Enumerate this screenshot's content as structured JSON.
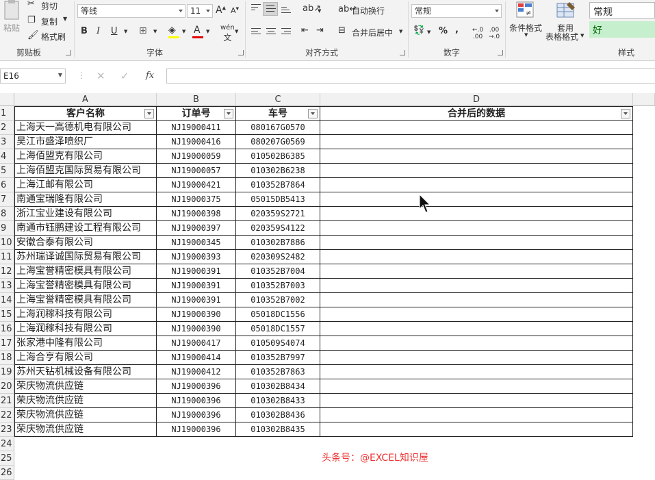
{
  "ribbon": {
    "clipboard": {
      "paste": "粘贴",
      "cut": "剪切",
      "copy": "复制",
      "format_painter": "格式刷",
      "label": "剪贴板"
    },
    "font": {
      "name": "等线",
      "size": "11",
      "bold": "B",
      "italic": "I",
      "underline": "U",
      "label": "字体"
    },
    "alignment": {
      "wrap_text": "自动换行",
      "merge_center": "合并后居中",
      "label": "对齐方式"
    },
    "number": {
      "format": "常规",
      "percent": "%",
      "comma": ",",
      "label": "数字"
    },
    "styles": {
      "conditional": "条件格式",
      "table_line1": "套用",
      "table_line2": "表格格式",
      "normal": "常规",
      "good": "好",
      "label": "样式"
    }
  },
  "formula_bar": {
    "name_box": "E16",
    "fx": "fx",
    "value": ""
  },
  "columns": [
    "A",
    "B",
    "C",
    "D"
  ],
  "headers": [
    "客户名称",
    "订单号",
    "车号",
    "合并后的数据"
  ],
  "rows": [
    [
      "上海天一高德机电有限公司",
      "NJ19000411",
      "080167G0570",
      ""
    ],
    [
      "吴江市盛泽喷织厂",
      "NJ19000416",
      "080207G0569",
      ""
    ],
    [
      "上海佰盟克有限公司",
      "NJ19000059",
      "010502B6385",
      ""
    ],
    [
      "上海佰盟克国际贸易有限公司",
      "NJ19000057",
      "010302B6238",
      ""
    ],
    [
      "上海江邮有限公司",
      "NJ19000421",
      "010352B7864",
      ""
    ],
    [
      "南通宝瑞隆有限公司",
      "NJ19000375",
      "05015DB5413",
      ""
    ],
    [
      "浙江宝业建设有限公司",
      "NJ19000398",
      "020359S2721",
      ""
    ],
    [
      "南通市钰鹏建设工程有限公司",
      "NJ19000397",
      "020359S4122",
      ""
    ],
    [
      "安徽合泰有限公司",
      "NJ19000345",
      "010302B7886",
      ""
    ],
    [
      "苏州瑞译诚国际贸易有限公司",
      "NJ19000393",
      "020309S2482",
      ""
    ],
    [
      "上海宝誉精密模具有限公司",
      "NJ19000391",
      "010352B7004",
      ""
    ],
    [
      "上海宝誉精密模具有限公司",
      "NJ19000391",
      "010352B7003",
      ""
    ],
    [
      "上海宝誉精密模具有限公司",
      "NJ19000391",
      "010352B7002",
      ""
    ],
    [
      "上海润稼科技有限公司",
      "NJ19000390",
      "05018DC1556",
      ""
    ],
    [
      "上海润稼科技有限公司",
      "NJ19000390",
      "05018DC1557",
      ""
    ],
    [
      "张家港中隆有限公司",
      "NJ19000417",
      "010509S4074",
      ""
    ],
    [
      "上海合亨有限公司",
      "NJ19000414",
      "010352B7997",
      ""
    ],
    [
      "苏州天钻机械设备有限公司",
      "NJ19000412",
      "010352B7863",
      ""
    ],
    [
      "荣庆物流供应链",
      "NJ19000396",
      "010302B8434",
      ""
    ],
    [
      "荣庆物流供应链",
      "NJ19000396",
      "010302B8433",
      ""
    ],
    [
      "荣庆物流供应链",
      "NJ19000396",
      "010302B8436",
      ""
    ],
    [
      "荣庆物流供应链",
      "NJ19000396",
      "010302B8435",
      ""
    ]
  ],
  "row_numbers": [
    "1",
    "2",
    "3",
    "4",
    "5",
    "6",
    "7",
    "8",
    "9",
    "10",
    "11",
    "12",
    "13",
    "14",
    "15",
    "16",
    "17",
    "18",
    "19",
    "20",
    "21",
    "22",
    "23",
    "24",
    "25",
    "26"
  ],
  "watermark": "头条号：@EXCEL知识屋",
  "colors": {
    "good_fill": "#c6efce",
    "good_text": "#006100",
    "watermark": "#ee3333",
    "font_red": "#e00000"
  }
}
